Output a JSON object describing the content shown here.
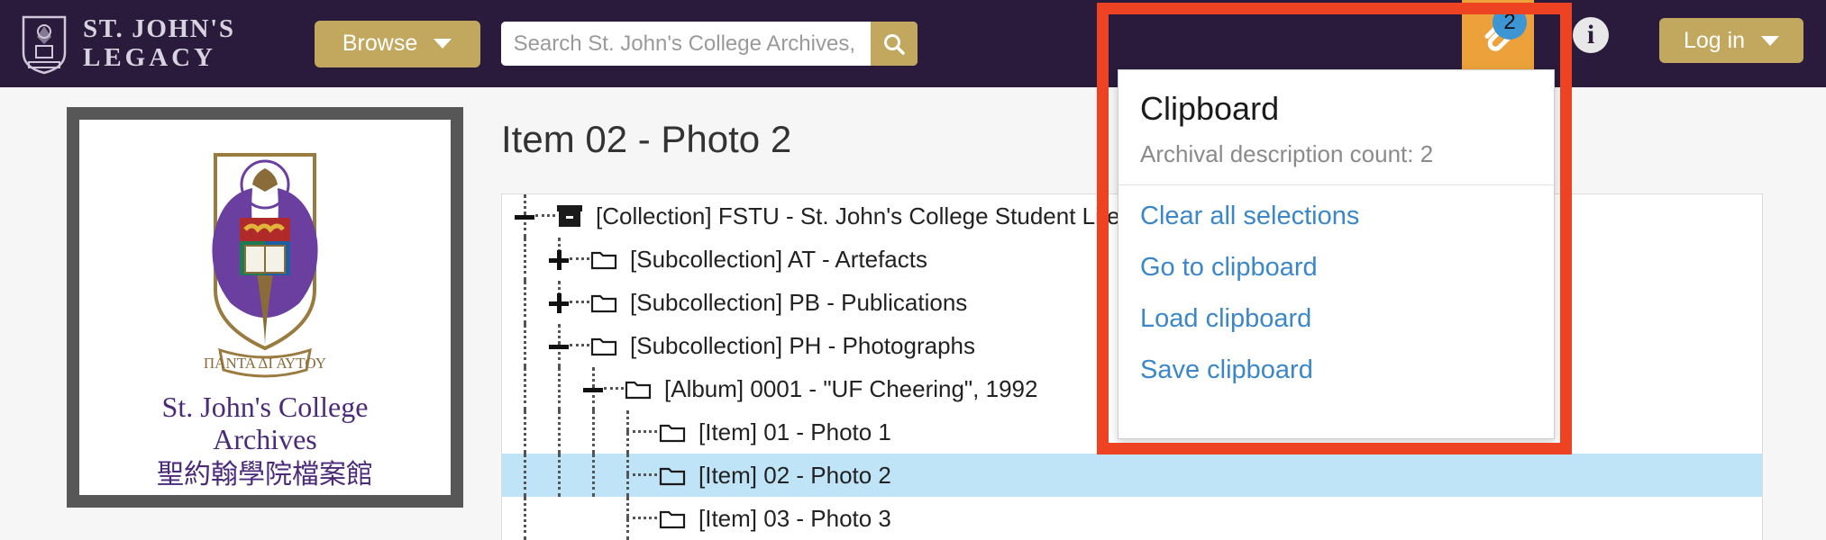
{
  "header": {
    "brand_line1": "ST. JOHN'S",
    "brand_line2": "LEGACY",
    "crest_icon": "college-crest-icon",
    "browse_label": "Browse",
    "browse_caret_icon": "caret-down-icon",
    "search": {
      "value": "",
      "placeholder": "Search St. John's College Archives, Hong Kong",
      "search_icon": "search-icon"
    },
    "clipboard": {
      "icon": "paperclip-icon",
      "badge_count": "2"
    },
    "info_icon_label": "i",
    "login_label": "Log in",
    "login_caret_icon": "caret-down-icon",
    "bg_color": "#2a1b3d",
    "accent_gold": "#c2a75e",
    "clipboard_orange": "#eda13a",
    "badge_blue": "#3e95d4"
  },
  "sidebar": {
    "logo_caption_line1": "St. John's College",
    "logo_caption_line2": "Archives",
    "logo_caption_cjk": "聖約翰學院檔案館",
    "crest_motto": "ΠΑΝΤΑ ΔΙ ΑΥΤΟΥ",
    "crest_icon": "college-crest-large-icon"
  },
  "main": {
    "page_title": "Item 02 - Photo 2",
    "tree": {
      "rows": [
        {
          "label": "[Collection] FSTU - St. John's College Student Life",
          "icon": "archive-box-icon",
          "toggle": "minus",
          "depth": 0,
          "selected": false
        },
        {
          "label": "[Subcollection] AT - Artefacts",
          "icon": "folder-icon",
          "toggle": "plus",
          "depth": 1,
          "selected": false
        },
        {
          "label": "[Subcollection] PB - Publications",
          "icon": "folder-icon",
          "toggle": "plus",
          "depth": 1,
          "selected": false
        },
        {
          "label": "[Subcollection] PH - Photographs",
          "icon": "folder-icon",
          "toggle": "minus",
          "depth": 1,
          "selected": false
        },
        {
          "label": "[Album] 0001 - \"UF Cheering\", 1992",
          "icon": "folder-icon",
          "toggle": "minus",
          "depth": 2,
          "selected": false
        },
        {
          "label": "[Item] 01 - Photo 1",
          "icon": "folder-icon",
          "toggle": "none",
          "depth": 3,
          "selected": false
        },
        {
          "label": "[Item] 02 - Photo 2",
          "icon": "folder-icon",
          "toggle": "none",
          "depth": 3,
          "selected": true
        },
        {
          "label": "[Item] 03 - Photo 3",
          "icon": "folder-icon",
          "toggle": "none",
          "depth": 3,
          "selected": false
        }
      ],
      "selected_bg": "#bfe3f7"
    }
  },
  "clipboard_panel": {
    "title": "Clipboard",
    "subtitle": "Archival description count: 2",
    "links": [
      "Clear all selections",
      "Go to clipboard",
      "Load clipboard",
      "Save clipboard"
    ],
    "link_color": "#3b87c9"
  },
  "annotation": {
    "shape": "rectangle-highlight",
    "color": "#ee4323"
  }
}
